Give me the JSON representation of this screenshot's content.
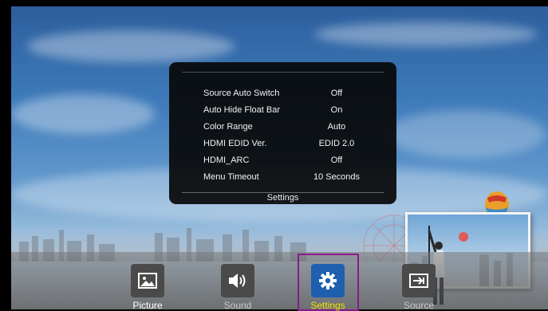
{
  "settings_panel": {
    "title": "Settings",
    "rows": [
      {
        "label": "Source Auto Switch",
        "value": "Off"
      },
      {
        "label": "Auto Hide Float Bar",
        "value": "On"
      },
      {
        "label": "Color Range",
        "value": "Auto"
      },
      {
        "label": "HDMI EDID Ver.",
        "value": "EDID 2.0"
      },
      {
        "label": "HDMI_ARC",
        "value": "Off"
      },
      {
        "label": "Menu Timeout",
        "value": "10 Seconds"
      }
    ]
  },
  "menubar": {
    "items": [
      {
        "label": "Picture",
        "icon": "picture-icon"
      },
      {
        "label": "Sound",
        "icon": "speaker-icon"
      },
      {
        "label": "Settings",
        "icon": "gear-icon",
        "selected": true
      },
      {
        "label": "Source",
        "icon": "input-source-icon"
      }
    ]
  },
  "colors": {
    "selected_text": "#f5e400",
    "selected_icon_bg": "#1e5fb0",
    "selection_border": "#8b1a8a"
  }
}
